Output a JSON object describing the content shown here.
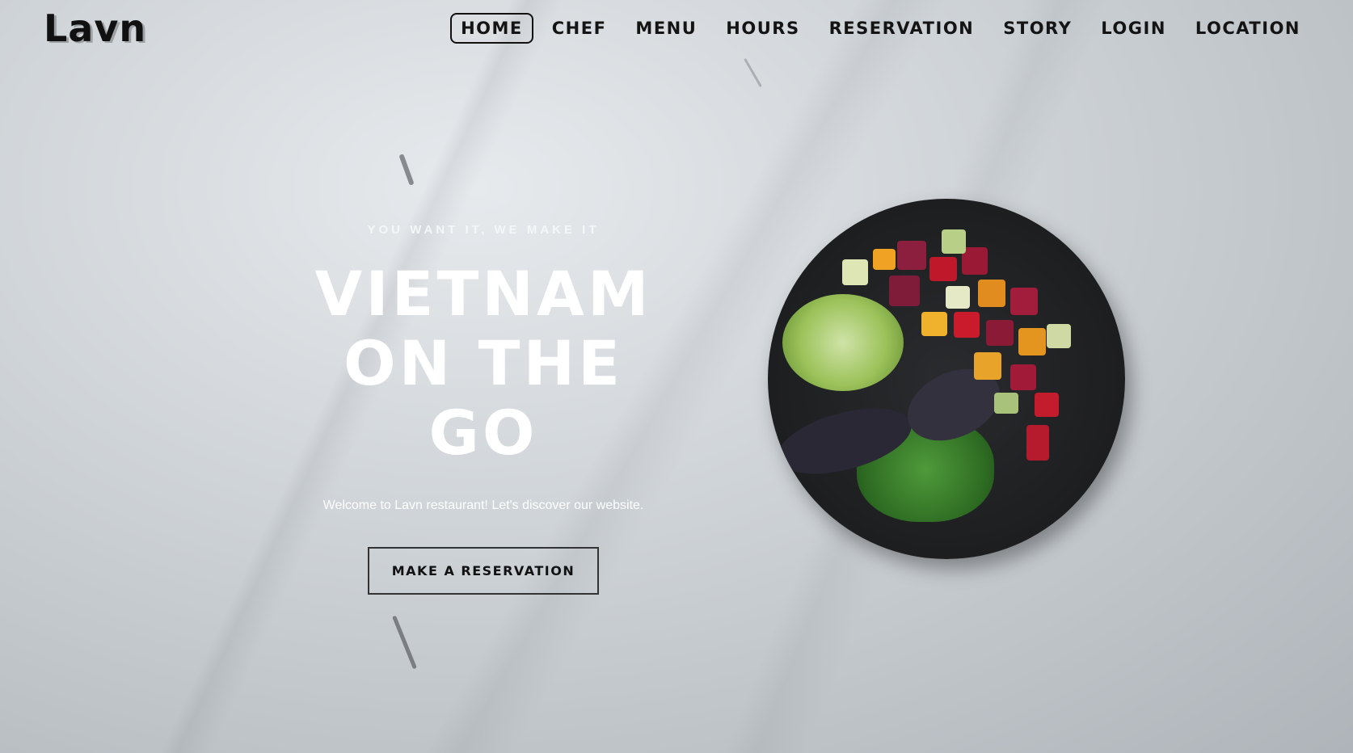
{
  "brand": {
    "logo": "Lavn"
  },
  "nav": {
    "items": [
      {
        "label": "HOME",
        "active": true
      },
      {
        "label": "CHEF"
      },
      {
        "label": "MENU"
      },
      {
        "label": "HOURS"
      },
      {
        "label": "RESERVATION"
      },
      {
        "label": "STORY"
      },
      {
        "label": "LOGIN"
      },
      {
        "label": "LOCATION"
      }
    ]
  },
  "hero": {
    "tagline": "YOU WANT IT, WE MAKE IT",
    "title_line1": "VIETNAM",
    "title_line2": "ON THE GO",
    "welcome": "Welcome to Lavn restaurant! Let's discover our website.",
    "cta_label": "MAKE A RESERVATION"
  },
  "colors": {
    "text_dark": "#111111",
    "hero_text": "#ffffff",
    "bowl": "#1f2022"
  },
  "images": {
    "dish": "poke-bowl-image"
  }
}
